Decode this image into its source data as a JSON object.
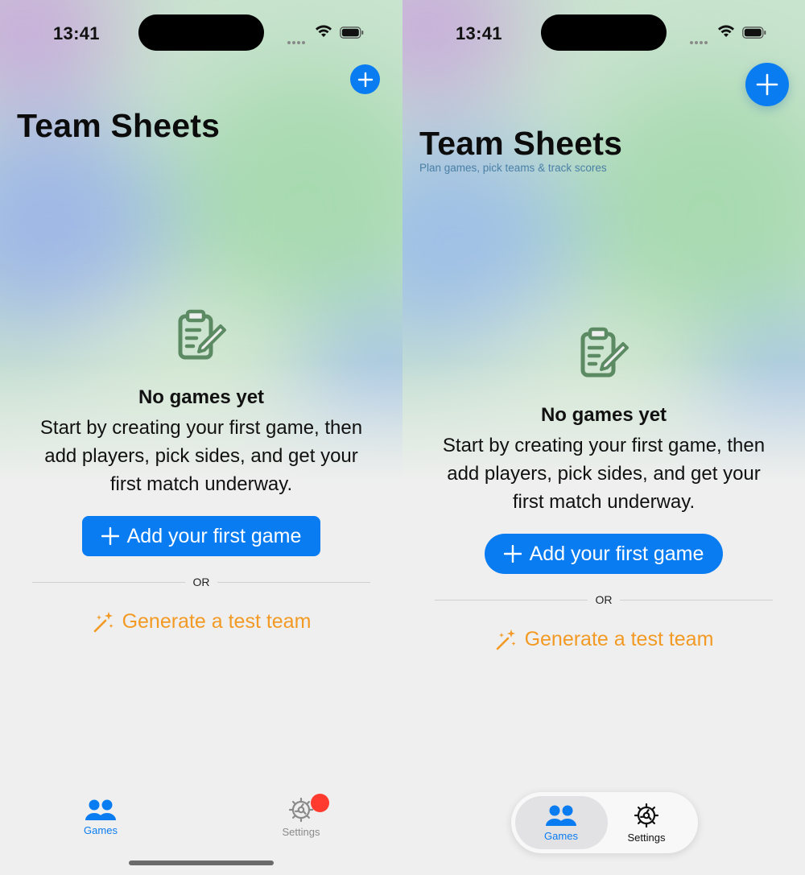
{
  "colors": {
    "accent": "#0a7cf2",
    "link_orange": "#f29a24",
    "icon_green": "#5b8a63",
    "subtitle_blue": "#4a7fa6",
    "badge_red": "#ff3b30"
  },
  "left": {
    "status": {
      "time": "13:41"
    },
    "add_icon": "plus-icon",
    "title": "Team Sheets",
    "empty_state": {
      "icon": "clipboard-pencil-icon",
      "title": "No games yet",
      "message": "Start by creating your first game, then add players, pick sides, and get your first match underway."
    },
    "primary_button": {
      "label": "Add your first game",
      "icon": "plus-icon"
    },
    "divider_text": "OR",
    "generate_link": {
      "label": "Generate a test team",
      "icon": "magic-wand-icon"
    },
    "tabs": [
      {
        "label": "Games",
        "icon": "people-icon",
        "selected": true
      },
      {
        "label": "Settings",
        "icon": "gear-icon",
        "selected": false,
        "badge": true
      }
    ]
  },
  "right": {
    "status": {
      "time": "13:41"
    },
    "add_icon": "plus-icon",
    "title": "Team Sheets",
    "subtitle": "Plan games, pick teams & track scores",
    "empty_state": {
      "icon": "clipboard-pencil-icon",
      "title": "No games yet",
      "message": "Start by creating your first game, then add players, pick sides, and get your first match underway."
    },
    "primary_button": {
      "label": "Add your first game",
      "icon": "plus-icon"
    },
    "divider_text": "OR",
    "generate_link": {
      "label": "Generate a test team",
      "icon": "magic-wand-icon"
    },
    "tabs": [
      {
        "label": "Games",
        "icon": "people-icon",
        "selected": true
      },
      {
        "label": "Settings",
        "icon": "gear-icon",
        "selected": false
      }
    ]
  }
}
